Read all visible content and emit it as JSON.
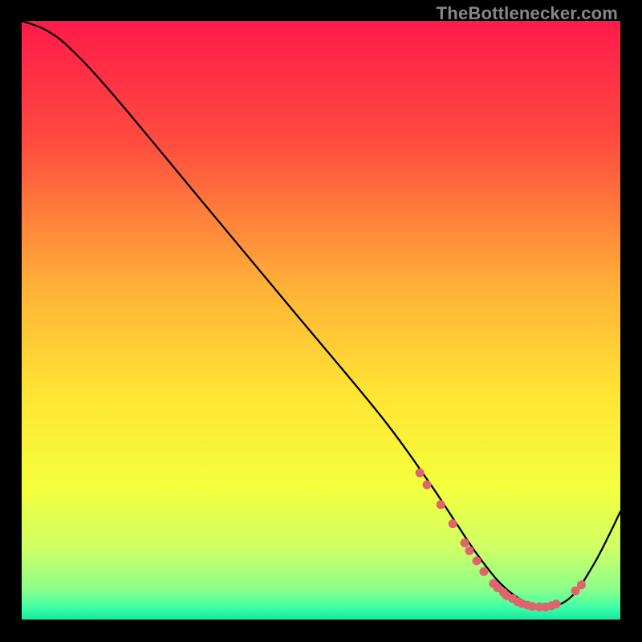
{
  "watermark": "TheBottlenecker.com",
  "chart_data": {
    "type": "line",
    "title": "",
    "xlabel": "",
    "ylabel": "",
    "xlim": [
      0,
      100
    ],
    "ylim": [
      0,
      100
    ],
    "grid": false,
    "background_gradient": {
      "stops": [
        {
          "offset": 0,
          "color": "#ff1a4b"
        },
        {
          "offset": 20,
          "color": "#ff4b3f"
        },
        {
          "offset": 45,
          "color": "#ffb337"
        },
        {
          "offset": 63,
          "color": "#ffe634"
        },
        {
          "offset": 78,
          "color": "#f4ff3c"
        },
        {
          "offset": 88,
          "color": "#cfff65"
        },
        {
          "offset": 95,
          "color": "#8bff8a"
        },
        {
          "offset": 98,
          "color": "#3effa6"
        },
        {
          "offset": 100,
          "color": "#16e7a0"
        }
      ]
    },
    "curve": {
      "x": [
        0,
        4,
        8,
        15,
        30,
        45,
        60,
        68,
        72,
        76,
        80,
        84,
        88,
        92,
        96,
        100
      ],
      "y": [
        100,
        98.5,
        95.5,
        88,
        70,
        52,
        34,
        23,
        17,
        11,
        6,
        3,
        2,
        4,
        10,
        18
      ]
    },
    "markers": {
      "color": "#e0646e",
      "points": [
        {
          "x": 66.5,
          "y": 24.5
        },
        {
          "x": 67.7,
          "y": 22.5
        },
        {
          "x": 70.0,
          "y": 19.2
        },
        {
          "x": 72.0,
          "y": 16.0
        },
        {
          "x": 74.0,
          "y": 12.8
        },
        {
          "x": 74.8,
          "y": 11.5
        },
        {
          "x": 76.0,
          "y": 9.8
        },
        {
          "x": 77.2,
          "y": 8.0
        },
        {
          "x": 78.8,
          "y": 6.0
        },
        {
          "x": 79.5,
          "y": 5.3
        },
        {
          "x": 80.5,
          "y": 4.5
        },
        {
          "x": 81.0,
          "y": 4.0
        },
        {
          "x": 82.0,
          "y": 3.5
        },
        {
          "x": 82.8,
          "y": 3.0
        },
        {
          "x": 83.5,
          "y": 2.7
        },
        {
          "x": 84.5,
          "y": 2.4
        },
        {
          "x": 85.3,
          "y": 2.2
        },
        {
          "x": 86.5,
          "y": 2.1
        },
        {
          "x": 87.5,
          "y": 2.1
        },
        {
          "x": 88.5,
          "y": 2.3
        },
        {
          "x": 89.3,
          "y": 2.6
        },
        {
          "x": 92.5,
          "y": 4.8
        },
        {
          "x": 93.5,
          "y": 5.8
        }
      ]
    }
  }
}
